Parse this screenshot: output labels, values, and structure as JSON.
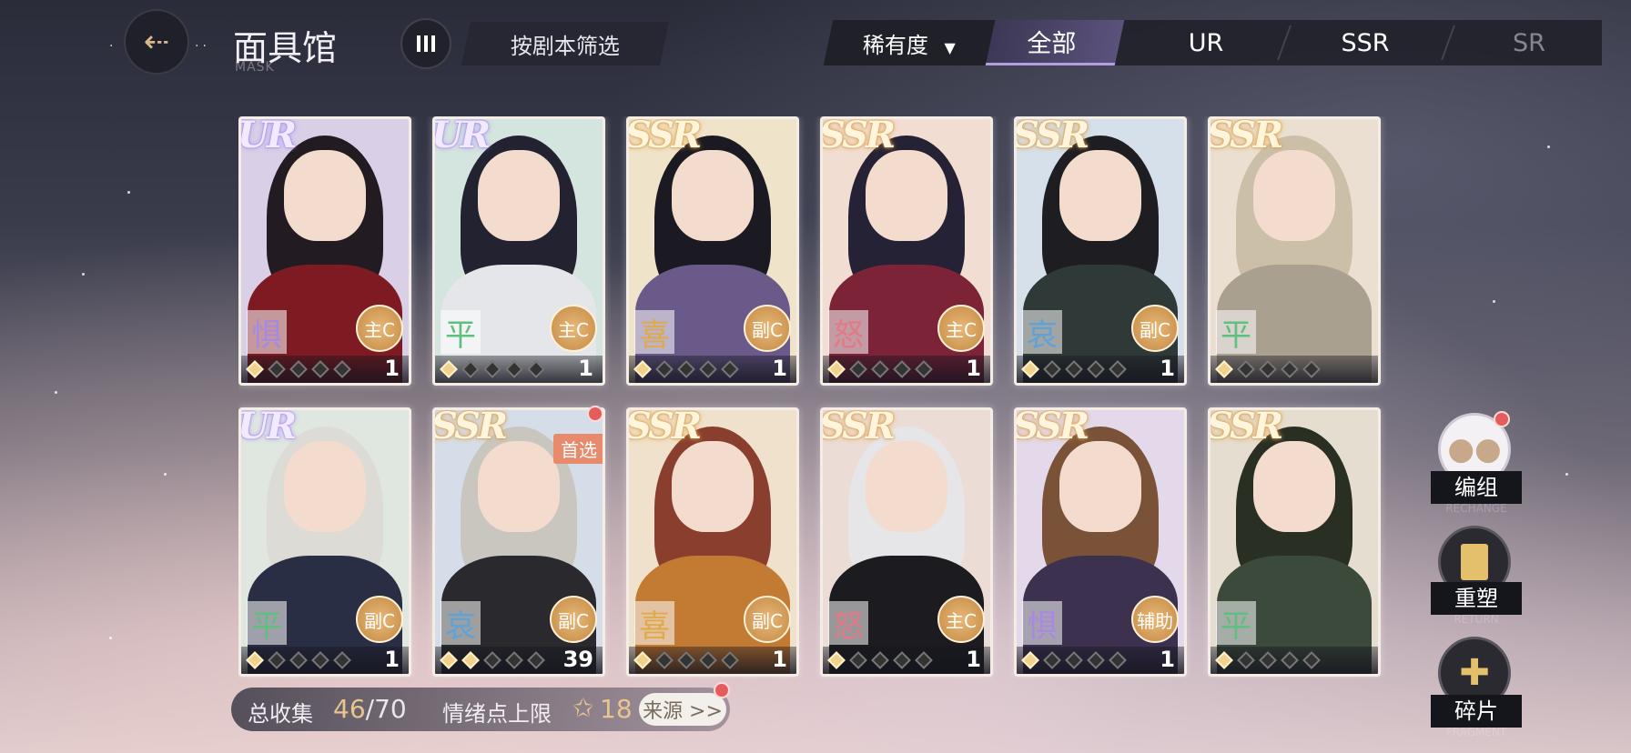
{
  "header": {
    "title": "面具馆",
    "subtitle": "MASK",
    "back_icon": "arrow-left-icon",
    "script_filter_label": "按剧本筛选",
    "rarity_dropdown_label": "稀有度",
    "rarity_dropdown_arrow": "▼",
    "tabs": [
      {
        "label": "全部",
        "active": true
      },
      {
        "label": "UR",
        "active": false
      },
      {
        "label": "SSR",
        "active": false
      },
      {
        "label": "SR",
        "active": false
      }
    ]
  },
  "cards": [
    {
      "rarity": "UR",
      "emotion": "惧",
      "role": "主C",
      "count": "1",
      "stars_on": 1,
      "first": false
    },
    {
      "rarity": "UR",
      "emotion": "平",
      "role": "主C",
      "count": "1",
      "stars_on": 1,
      "first": false
    },
    {
      "rarity": "SSR",
      "emotion": "喜",
      "role": "副C",
      "count": "1",
      "stars_on": 1,
      "first": false
    },
    {
      "rarity": "SSR",
      "emotion": "怒",
      "role": "主C",
      "count": "1",
      "stars_on": 1,
      "first": false
    },
    {
      "rarity": "SSR",
      "emotion": "哀",
      "role": "副C",
      "count": "1",
      "stars_on": 1,
      "first": false
    },
    {
      "rarity": "SSR",
      "emotion": "平",
      "role": "",
      "count": "",
      "stars_on": 1,
      "first": false
    },
    {
      "rarity": "UR",
      "emotion": "平",
      "role": "副C",
      "count": "1",
      "stars_on": 1,
      "first": false
    },
    {
      "rarity": "SSR",
      "emotion": "哀",
      "role": "副C",
      "count": "39",
      "stars_on": 2,
      "first": true,
      "first_label": "首选"
    },
    {
      "rarity": "SSR",
      "emotion": "喜",
      "role": "副C",
      "count": "1",
      "stars_on": 1,
      "first": false
    },
    {
      "rarity": "SSR",
      "emotion": "怒",
      "role": "主C",
      "count": "1",
      "stars_on": 1,
      "first": false
    },
    {
      "rarity": "SSR",
      "emotion": "惧",
      "role": "辅助",
      "count": "1",
      "stars_on": 1,
      "first": false
    },
    {
      "rarity": "SSR",
      "emotion": "平",
      "role": "",
      "count": "",
      "stars_on": 1,
      "first": false
    }
  ],
  "footer": {
    "collect_label": "总收集",
    "collect_value": "46",
    "collect_total": "/70",
    "emotion_cap_label": "情绪点上限",
    "emotion_cap_value": "18",
    "source_label": "来源 >>"
  },
  "side": {
    "group_label": "编组",
    "group_sub": "RECHANGE",
    "reshape_label": "重塑",
    "reshape_sub": "RETURN",
    "fragment_label": "碎片",
    "fragment_sub": "FRAGMENT"
  },
  "colors": {
    "accent_gold": "#e7c58c",
    "tab_active": "#5b527c",
    "notify_red": "#e45d5d"
  }
}
